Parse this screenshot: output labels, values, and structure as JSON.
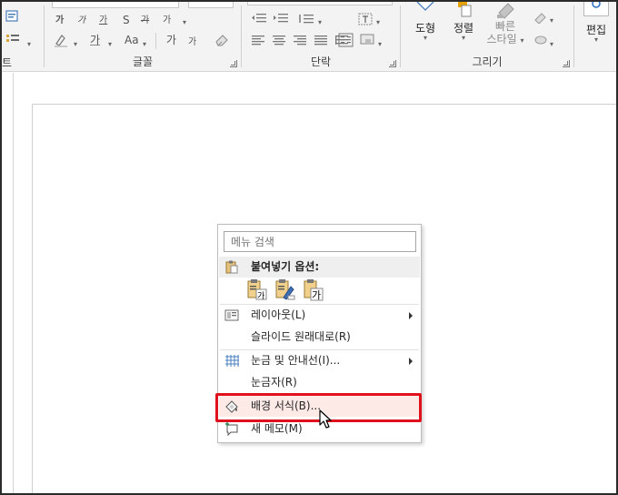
{
  "ribbon": {
    "groups": {
      "font": "글꼴",
      "paragraph": "단락",
      "drawing": "그리기"
    },
    "left_fragment": "트",
    "font_row1": [
      "가",
      "가",
      "가",
      "S",
      "가",
      "가"
    ],
    "font_row2": [
      "가",
      "가",
      "Aa",
      "가",
      "가"
    ],
    "drawing_buttons": {
      "shapes": "도형",
      "arrange": "정렬",
      "quick_styles_1": "빠른",
      "quick_styles_2": "스타일"
    },
    "editing": "편집"
  },
  "context_menu": {
    "search_placeholder": "메뉴 검색",
    "paste_options": "붙여넣기 옵션:",
    "paste_icon_glyphs": [
      "가",
      "가",
      "가"
    ],
    "items": [
      {
        "label": "레이아웃(L)",
        "has_submenu": true
      },
      {
        "label": "슬라이드 원래대로(R)",
        "has_submenu": false
      },
      {
        "label": "눈금 및 안내선(I)...",
        "has_submenu": true
      },
      {
        "label": "눈금자(R)",
        "has_submenu": false
      },
      {
        "label": "배경 서식(B)...",
        "has_submenu": false,
        "highlighted": true
      },
      {
        "label": "새 메모(M)",
        "has_submenu": false
      }
    ]
  },
  "colors": {
    "highlight_border": "#e0111d",
    "highlight_fill": "#fde9e6",
    "ribbon_bg": "#f3f3f3"
  }
}
